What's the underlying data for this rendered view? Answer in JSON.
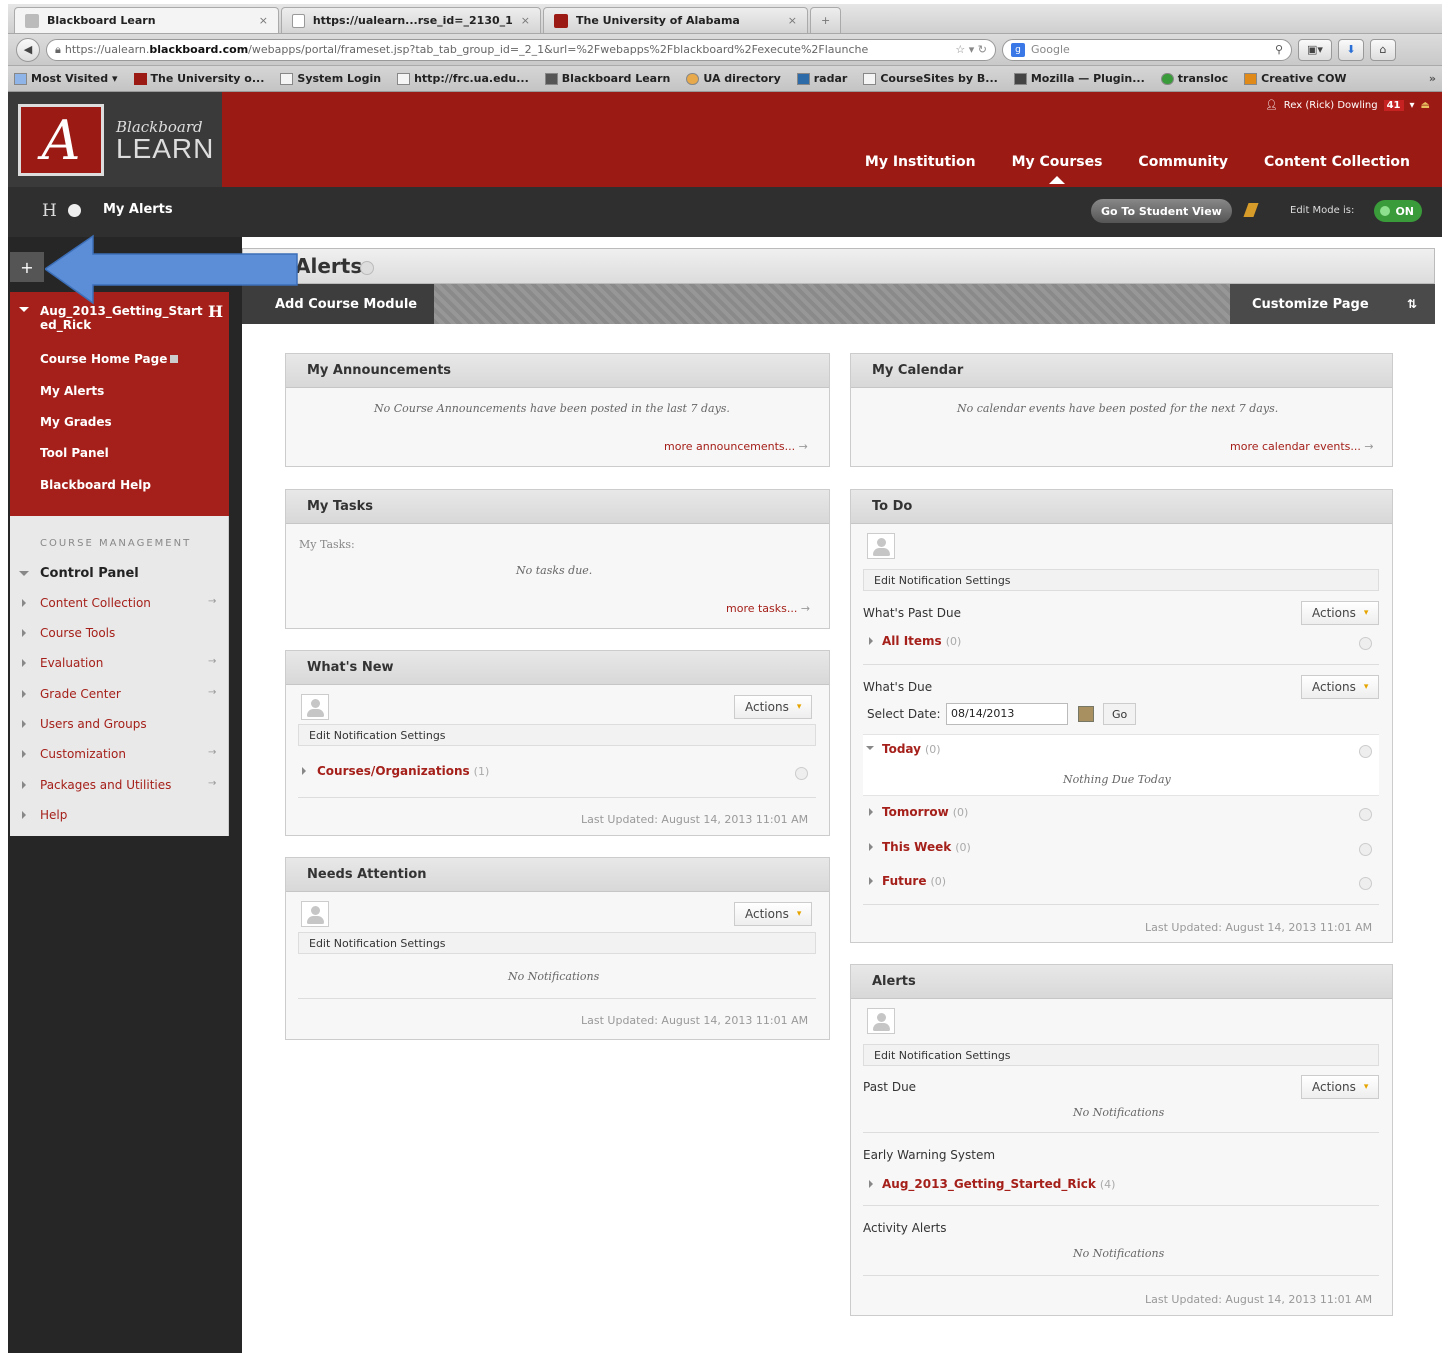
{
  "browser": {
    "tabs": [
      {
        "label": "Blackboard Learn",
        "close": "×"
      },
      {
        "label": "https://ualearn...rse_id=_2130_1",
        "close": "×"
      },
      {
        "label": "The University of Alabama",
        "close": "×"
      }
    ],
    "new_tab": "+",
    "url_prefix": "https://ualearn.",
    "url_domain": "blackboard.com",
    "url_rest": "/webapps/portal/frameset.jsp?tab_tab_group_id=_2_1&url=%2Fwebapps%2Fblackboard%2Fexecute%2Flaunche",
    "search_placeholder": "Google",
    "bookmarks": [
      "Most Visited ▾",
      "The University o...",
      "System Login",
      "http://frc.ua.edu...",
      "Blackboard Learn",
      "UA directory",
      "radar",
      "CourseSites by B...",
      "Mozilla — Plugin...",
      "transloc",
      "Creative COW"
    ],
    "bookmarks_overflow": "»"
  },
  "header": {
    "logo_letter": "A",
    "logo_line1": "Blackboard",
    "logo_line2": "LEARN",
    "user_name": "Rex (Rick) Dowling",
    "notification_count": "41",
    "tabs": [
      "My Institution",
      "My Courses",
      "Community",
      "Content Collection"
    ],
    "active_tab": "My Courses"
  },
  "subbar": {
    "h_label": "H",
    "breadcrumb": "My Alerts",
    "student_view": "Go To Student View",
    "edit_mode_label": "Edit Mode is:",
    "edit_mode_state": "ON"
  },
  "sidebar": {
    "plus": "+",
    "course_title": "Aug_2013_Getting_Started_Rick",
    "h_label": "H",
    "menu_items": [
      "Course Home Page",
      "My Alerts",
      "My Grades",
      "Tool Panel",
      "Blackboard Help"
    ],
    "management_heading": "COURSE MANAGEMENT",
    "control_panel": "Control Panel",
    "management_items": [
      "Content Collection",
      "Course Tools",
      "Evaluation",
      "Grade Center",
      "Users and Groups",
      "Customization",
      "Packages and Utilities",
      "Help"
    ],
    "arrow": "→"
  },
  "page": {
    "title": "Alerts",
    "add_module": "Add Course Module",
    "customize": "Customize Page",
    "sort_icon": "⇅"
  },
  "modules": {
    "announcements": {
      "title": "My Announcements",
      "empty": "No Course Announcements have been posted in the last 7 days.",
      "more": "more announcements..."
    },
    "calendar": {
      "title": "My Calendar",
      "empty": "No calendar events have been posted for the next 7 days.",
      "more": "more calendar events..."
    },
    "tasks": {
      "title": "My Tasks",
      "label": "My Tasks:",
      "empty": "No tasks due.",
      "more": "more tasks..."
    },
    "whats_new": {
      "title": "What's New",
      "actions": "Actions",
      "edit_settings": "Edit Notification Settings",
      "item": "Courses/Organizations",
      "item_count": "(1)",
      "updated": "Last Updated: August 14, 2013 11:01 AM"
    },
    "needs_attention": {
      "title": "Needs Attention",
      "actions": "Actions",
      "edit_settings": "Edit Notification Settings",
      "empty": "No Notifications",
      "updated": "Last Updated: August 14, 2013 11:01 AM"
    },
    "todo": {
      "title": "To Do",
      "edit_settings": "Edit Notification Settings",
      "past_due": "What's Past Due",
      "actions": "Actions",
      "all_items": "All Items",
      "all_items_count": "(0)",
      "whats_due": "What's Due",
      "select_date": "Select Date:",
      "date_value": "08/14/2013",
      "go": "Go",
      "today": "Today",
      "today_count": "(0)",
      "nothing_due": "Nothing Due Today",
      "tomorrow": "Tomorrow",
      "tomorrow_count": "(0)",
      "this_week": "This Week",
      "this_week_count": "(0)",
      "future": "Future",
      "future_count": "(0)",
      "updated": "Last Updated: August 14, 2013 11:01 AM"
    },
    "alerts": {
      "title": "Alerts",
      "edit_settings": "Edit Notification Settings",
      "past_due": "Past Due",
      "actions": "Actions",
      "no_notifications": "No Notifications",
      "early_warning": "Early Warning System",
      "course_link": "Aug_2013_Getting_Started_Rick",
      "course_count": "(4)",
      "activity_alerts": "Activity Alerts",
      "no_notifications2": "No Notifications",
      "updated": "Last Updated: August 14, 2013 11:01 AM"
    }
  },
  "colors": {
    "brand_red": "#9c1a14",
    "link_red": "#a5201a",
    "arrow_blue": "#5b8ed6"
  }
}
